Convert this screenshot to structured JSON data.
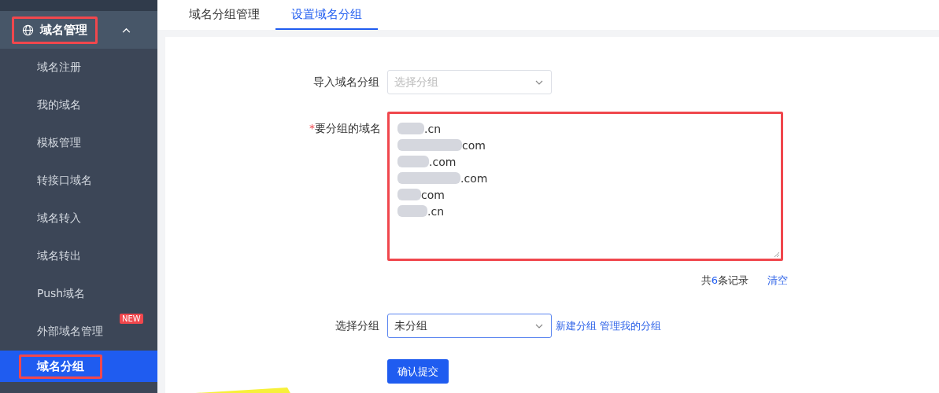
{
  "sidebar": {
    "header": {
      "label": "域名管理",
      "expanded": true,
      "highlighted": true
    },
    "items": [
      {
        "label": "域名注册",
        "selected": false,
        "highlighted": false
      },
      {
        "label": "我的域名",
        "selected": false,
        "highlighted": false
      },
      {
        "label": "模板管理",
        "selected": false,
        "highlighted": false
      },
      {
        "label": "转接口域名",
        "selected": false,
        "highlighted": false
      },
      {
        "label": "域名转入",
        "selected": false,
        "highlighted": false
      },
      {
        "label": "域名转出",
        "selected": false,
        "highlighted": false
      },
      {
        "label": "Push域名",
        "selected": false,
        "highlighted": false
      },
      {
        "label": "外部域名管理",
        "selected": false,
        "highlighted": false,
        "badge": "NEW"
      },
      {
        "label": "域名分组",
        "selected": true,
        "highlighted": true
      }
    ]
  },
  "tabs": [
    {
      "label": "域名分组管理",
      "selected": false
    },
    {
      "label": "设置域名分组",
      "selected": true
    }
  ],
  "form": {
    "import_group": {
      "label": "导入域名分组",
      "placeholder": "选择分组"
    },
    "domains": {
      "label": "要分组的域名",
      "required": true,
      "required_mark": "*",
      "highlighted": true,
      "lines": [
        {
          "text": ".cn"
        },
        {
          "text": "com"
        },
        {
          "text": ".com"
        },
        {
          "text": ".com"
        },
        {
          "text": "com"
        },
        {
          "text": ".cn"
        }
      ]
    },
    "record_count": {
      "prefix": "共",
      "count": "6",
      "suffix": "条记录"
    },
    "clear_link": "清空",
    "group": {
      "label": "选择分组",
      "value": "未分组",
      "focused": true
    },
    "links": [
      "新建分组",
      "管理我的分组"
    ],
    "submit": "确认提交"
  }
}
